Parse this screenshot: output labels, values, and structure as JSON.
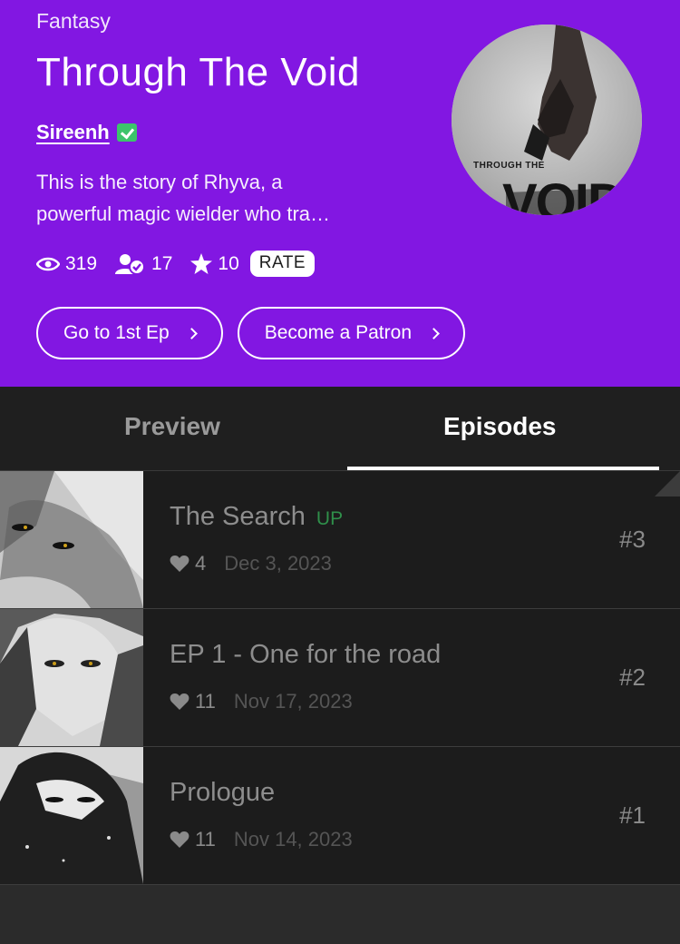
{
  "series": {
    "genre": "Fantasy",
    "title": "Through The Void",
    "author": "Sireenh",
    "description_line1": "This is the story of Rhyva, a",
    "description_line2": "powerful magic wielder who tra…",
    "views": "319",
    "subscribers": "17",
    "rating": "10",
    "rate_label": "RATE",
    "cover_text_small": "THROUGH THE",
    "cover_text_large": "VOID"
  },
  "actions": {
    "first_ep_label": "Go to 1st Ep",
    "patron_label": "Become a Patron"
  },
  "tabs": {
    "preview": "Preview",
    "episodes": "Episodes"
  },
  "episodes": [
    {
      "title": "The Search",
      "badge": "UP",
      "likes": "4",
      "date": "Dec 3, 2023",
      "number": "#3"
    },
    {
      "title": "EP 1 - One for the road",
      "badge": "",
      "likes": "11",
      "date": "Nov 17, 2023",
      "number": "#2"
    },
    {
      "title": "Prologue",
      "badge": "",
      "likes": "11",
      "date": "Nov 14, 2023",
      "number": "#1"
    }
  ],
  "colors": {
    "header_bg": "#8217e2",
    "verified": "#3cc46b",
    "up_badge": "#2f8f4a",
    "list_bg": "#1c1c1c"
  }
}
